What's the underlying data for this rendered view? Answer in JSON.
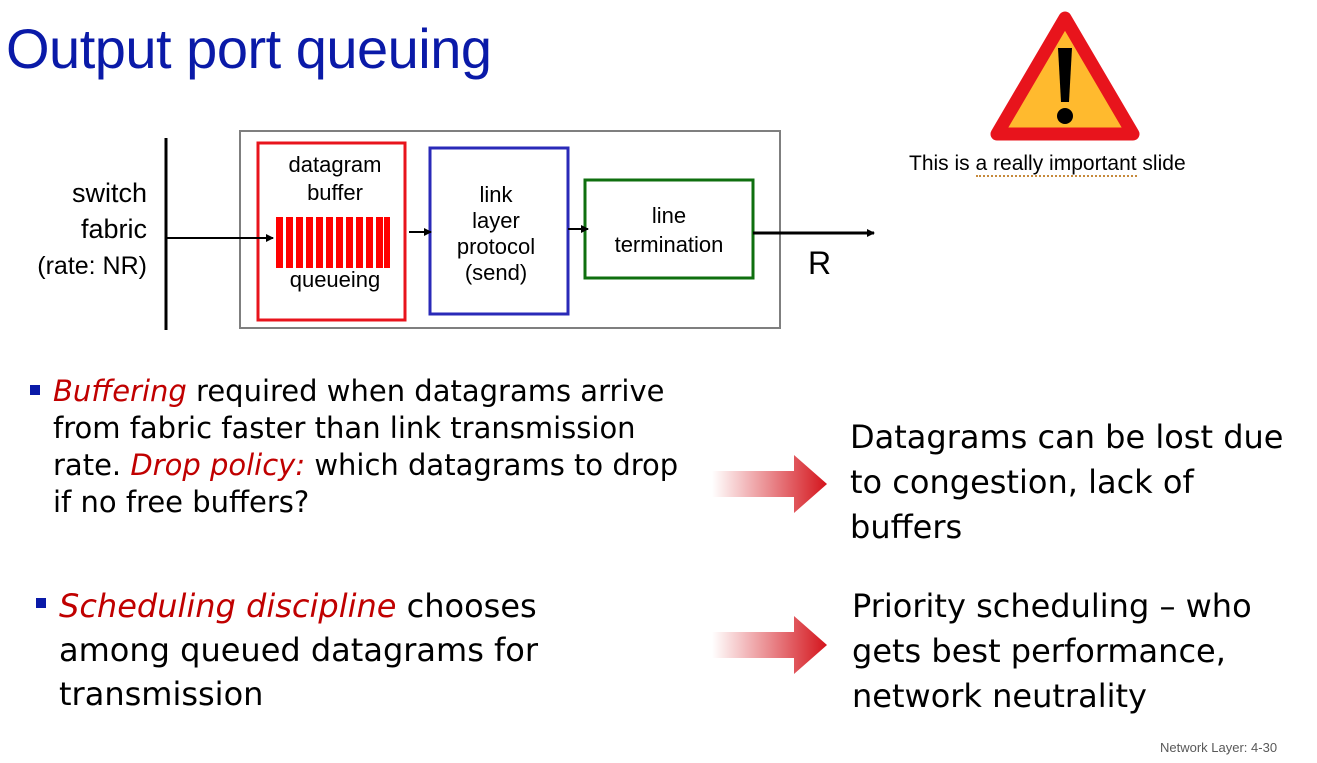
{
  "slide": {
    "title": "Output port queuing",
    "footer": "Network Layer: 4-30"
  },
  "diagram": {
    "fabric_label": [
      "switch",
      "fabric",
      "(rate: NR)"
    ],
    "buffer_label": [
      "datagram",
      "buffer"
    ],
    "queueing_label": "queueing",
    "link_layer_label": [
      "link",
      "layer",
      "protocol",
      "(send)"
    ],
    "line_termination_label": [
      "line",
      "termination"
    ],
    "rate_label": "R",
    "colors": {
      "buffer": "#e8141c",
      "link_layer": "#2a2ab8",
      "line_termination": "#0f6f0f",
      "outer_box": "#7f7f7f"
    }
  },
  "warning": {
    "icon": "warning-triangle-icon",
    "note_prefix": "This is ",
    "note_underlined": "a really important",
    "note_suffix": " slide"
  },
  "bullets": [
    {
      "segments": [
        {
          "text": "Buffering",
          "emphasis": true
        },
        {
          "text": " required when datagrams arrive from fabric faster than link transmission rate. ",
          "emphasis": false
        },
        {
          "text": "Drop policy:",
          "emphasis": true
        },
        {
          "text": " which datagrams to drop if no free buffers?",
          "emphasis": false
        }
      ]
    },
    {
      "segments": [
        {
          "text": "Scheduling discipline",
          "emphasis": true
        },
        {
          "text": " chooses among queued datagrams for transmission",
          "emphasis": false
        }
      ]
    }
  ],
  "consequences": [
    "Datagrams can be lost due to congestion, lack of buffers",
    "Priority scheduling – who gets best performance, network neutrality"
  ]
}
